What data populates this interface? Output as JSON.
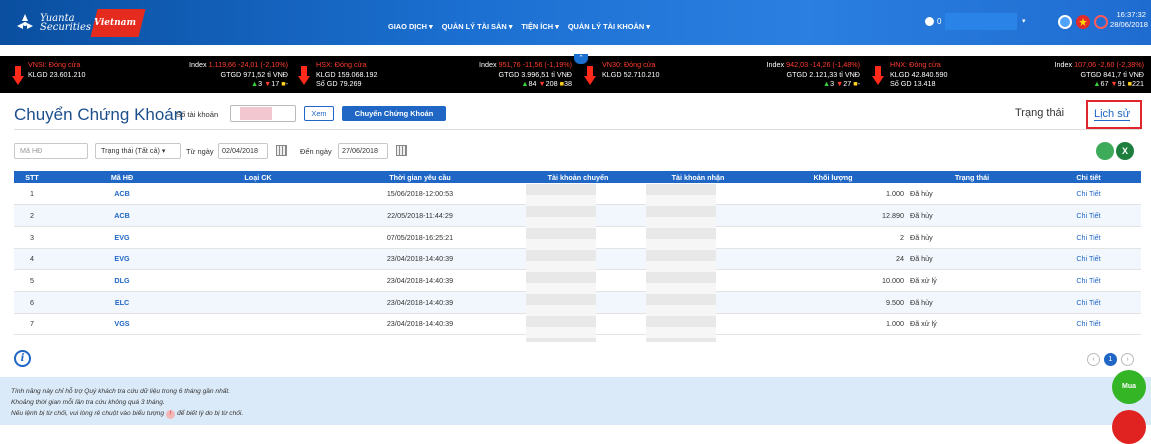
{
  "header": {
    "logo_text_line1": "Yuanta",
    "logo_text_line2": "Securities",
    "logo_text_vietnam": "Vietnam",
    "menu": [
      "GIAO DỊCH ▾",
      "QUẢN LÝ TÀI SẢN ▾",
      "TIỆN ÍCH ▾",
      "QUẢN LÝ TÀI KHOẢN ▾"
    ],
    "user_count": "0",
    "time": "16:37:32",
    "date": "28/06/2018"
  },
  "ticker": [
    {
      "name": "VNSI: Đóng cửa",
      "klgd": "KLGD 23.601.210",
      "index_label": "Index",
      "index_value": "1.119,66 -24,01 (-2,10%)",
      "gtgd": "GTGD 971,52 tỉ VNĐ",
      "up": "3",
      "down": "17",
      "ref": "-"
    },
    {
      "name": "HSX: Đóng cửa",
      "klgd": "KLGD 159.068.192",
      "sogd": "Số GD 79.269",
      "index_label": "Index",
      "index_value": "951,76 -11,56 (-1,19%)",
      "gtgd": "GTGD 3.996,51 tỉ VNĐ",
      "up": "84",
      "down": "208",
      "ref": "38"
    },
    {
      "name": "VN30: Đóng cửa",
      "klgd": "KLGD 52.710.210",
      "index_label": "Index",
      "index_value": "942,03 -14,26 (-1,48%)",
      "gtgd": "GTGD 2.121,33 tỉ VNĐ",
      "up": "3",
      "down": "27",
      "ref": "-"
    },
    {
      "name": "HNX: Đóng cửa",
      "klgd": "KLGD 42.840.590",
      "sogd": "Số GD 13.418",
      "index_label": "Index",
      "index_value": "107,06 -2,60 (-2,38%)",
      "gtgd": "GTGD 841,7 tỉ VNĐ",
      "up": "67",
      "down": "91",
      "ref": "221"
    }
  ],
  "page": {
    "title": "Chuyển Chứng Khoán",
    "account_label": "Số tài khoản",
    "view_button": "Xem",
    "transfer_button": "Chuyển Chứng Khoán",
    "tab_status": "Trạng thái",
    "tab_history": "Lịch sử"
  },
  "filters": {
    "mahd_placeholder": "Mã HĐ",
    "status_select": "Trạng thái (Tất cả)",
    "from_label": "Từ ngày",
    "from_value": "02/04/2018",
    "to_label": "Đến ngày",
    "to_value": "27/06/2018"
  },
  "table": {
    "headers": [
      "STT",
      "Mã HĐ",
      "Loại CK",
      "Thời gian yêu cầu",
      "Tài khoản chuyển",
      "Tài khoản nhận",
      "Khối lượng",
      "Trạng thái",
      "Chi tiết"
    ],
    "rows": [
      {
        "stt": "1",
        "mahd": "ACB",
        "loai": "",
        "time": "15/06/2018-12:00:53",
        "kl": "1.000",
        "status": "Đã hủy",
        "detail": "Chi Tiết"
      },
      {
        "stt": "2",
        "mahd": "ACB",
        "loai": "",
        "time": "22/05/2018-11:44:29",
        "kl": "12.890",
        "status": "Đã hủy",
        "detail": "Chi Tiết"
      },
      {
        "stt": "3",
        "mahd": "EVG",
        "loai": "",
        "time": "07/05/2018-16:25:21",
        "kl": "2",
        "status": "Đã hủy",
        "detail": "Chi Tiết"
      },
      {
        "stt": "4",
        "mahd": "EVG",
        "loai": "",
        "time": "23/04/2018-14:40:39",
        "kl": "24",
        "status": "Đã hủy",
        "detail": "Chi Tiết"
      },
      {
        "stt": "5",
        "mahd": "DLG",
        "loai": "",
        "time": "23/04/2018-14:40:39",
        "kl": "10.000",
        "status": "Đã xử lý",
        "detail": "Chi Tiết"
      },
      {
        "stt": "6",
        "mahd": "ELC",
        "loai": "",
        "time": "23/04/2018-14:40:39",
        "kl": "9.500",
        "status": "Đã hủy",
        "detail": "Chi Tiết"
      },
      {
        "stt": "7",
        "mahd": "VGS",
        "loai": "",
        "time": "23/04/2018-14:40:39",
        "kl": "1.000",
        "status": "Đã xử lý",
        "detail": "Chi Tiết"
      }
    ]
  },
  "pagination": {
    "prev": "‹",
    "current": "1",
    "next": "›"
  },
  "notes": {
    "line1": "Tính năng này chỉ hỗ trợ Quý khách tra cứu dữ liệu trong 6 tháng gần nhất.",
    "line2": "Khoảng thời gian mỗi lần tra cứu không quá 3 tháng.",
    "line3a": "Nếu lệnh bị từ chối, vui lòng rê chuột vào biểu tượng",
    "line3b": "để biết lý do bị từ chối."
  },
  "fab": {
    "buy": "Mua"
  },
  "colors": {
    "primary": "#1f66c5",
    "header": "#1b6fd0",
    "highlight": "#e0262a"
  }
}
